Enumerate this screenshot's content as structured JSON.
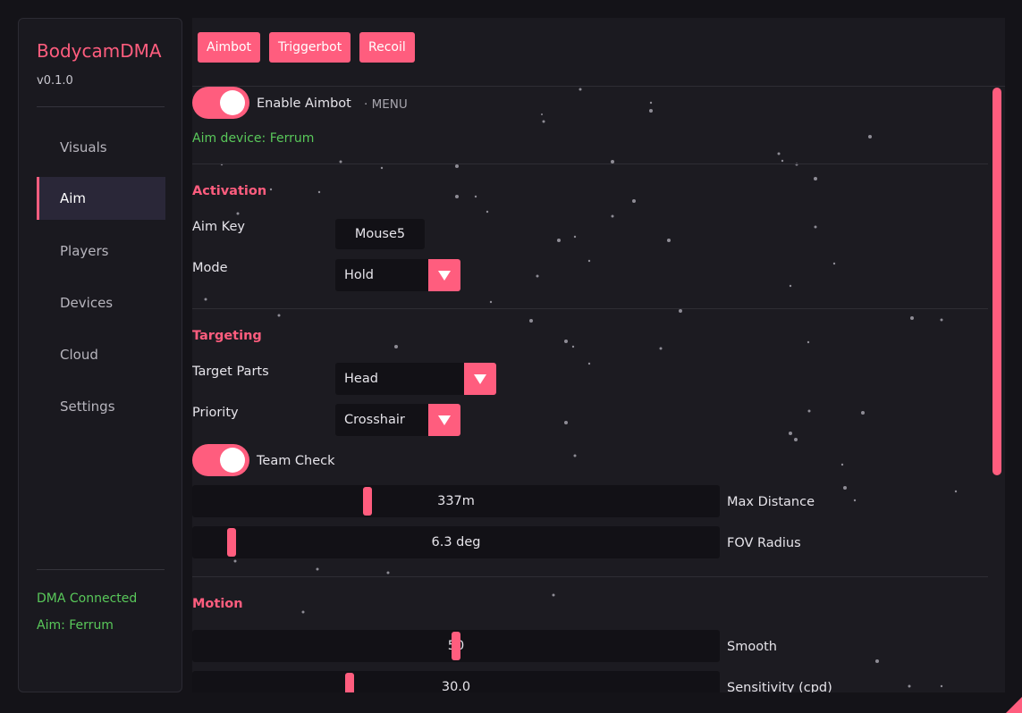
{
  "app": {
    "title": "BodycamDMA",
    "version": "v0.1.0"
  },
  "sidebar": {
    "items": [
      {
        "label": "Visuals"
      },
      {
        "label": "Aim"
      },
      {
        "label": "Players"
      },
      {
        "label": "Devices"
      },
      {
        "label": "Cloud"
      },
      {
        "label": "Settings"
      }
    ],
    "active": "Aim",
    "status": {
      "dma": "DMA Connected",
      "aim": "Aim: Ferrum"
    }
  },
  "tabs": [
    {
      "label": "Aimbot"
    },
    {
      "label": "Triggerbot"
    },
    {
      "label": "Recoil"
    }
  ],
  "aim": {
    "enable_label": "Enable Aimbot",
    "enable_on": true,
    "menu_hint": "· MENU",
    "device_text": "Aim device: Ferrum",
    "activation": {
      "title": "Activation",
      "aim_key_label": "Aim Key",
      "aim_key_value": "Mouse5",
      "mode_label": "Mode",
      "mode_value": "Hold"
    },
    "targeting": {
      "title": "Targeting",
      "parts_label": "Target Parts",
      "parts_value": "Head",
      "priority_label": "Priority",
      "priority_value": "Crosshair",
      "team_check_label": "Team Check",
      "team_check_on": true,
      "max_distance": {
        "label": "Max Distance",
        "value": "337m",
        "fraction": 0.33
      },
      "fov_radius": {
        "label": "FOV Radius",
        "value": "6.3 deg",
        "fraction": 0.068
      }
    },
    "motion": {
      "title": "Motion",
      "smooth": {
        "label": "Smooth",
        "value": "50",
        "fraction": 0.5
      },
      "sensitivity": {
        "label": "Sensitivity (cpd)",
        "value": "30.0",
        "fraction": 0.295
      }
    }
  },
  "colors": {
    "accent": "#ff5d7e",
    "status_green": "#59c85a",
    "panel": "#1c1b21",
    "field": "#121116"
  },
  "scroll": {
    "position": 0.0,
    "visible_fraction": 0.64
  }
}
